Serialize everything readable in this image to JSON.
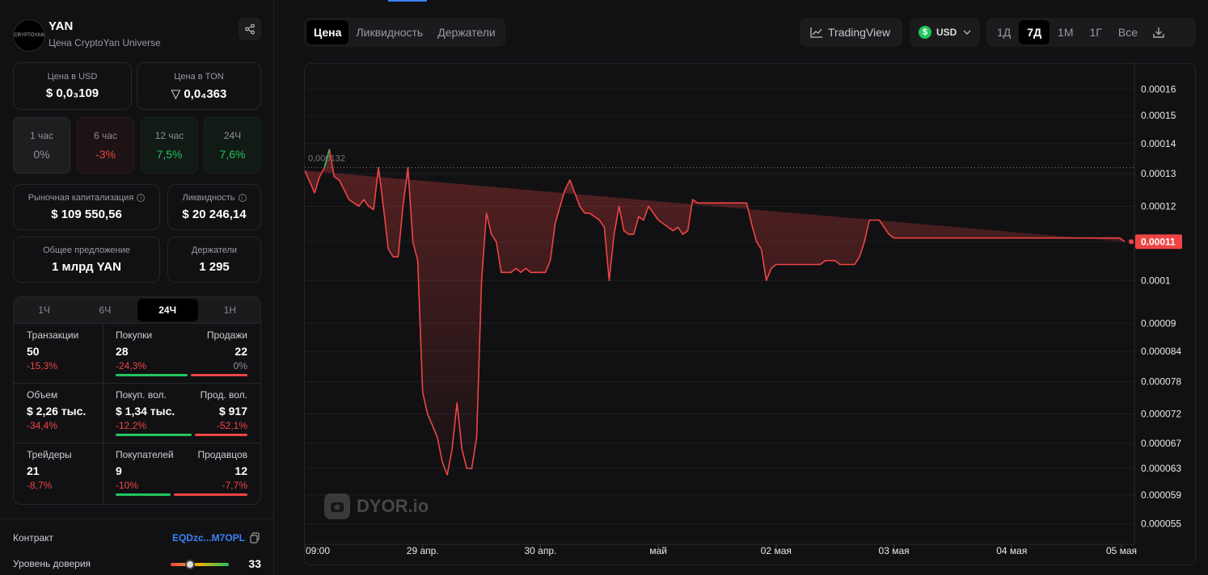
{
  "token": {
    "name": "YAN",
    "subtitle": "Цена CryptoYan Universe",
    "logo_text": "CRYPTOYAN"
  },
  "price": {
    "usd_label": "Цена в USD",
    "usd_value": "$ 0,0₃109",
    "ton_label": "Цена в TON",
    "ton_value": "▽ 0,0₄363"
  },
  "changes": [
    {
      "label": "1 час",
      "value": "0%",
      "tone": "neutral"
    },
    {
      "label": "6 час",
      "value": "-3%",
      "tone": "negative"
    },
    {
      "label": "12 час",
      "value": "7,5%",
      "tone": "positive"
    },
    {
      "label": "24Ч",
      "value": "7,6%",
      "tone": "positive"
    }
  ],
  "metrics": {
    "mcap_label": "Рыночная капитализация",
    "mcap_value": "$ 109 550,56",
    "liq_label": "Ликвидность",
    "liq_value": "$ 20 246,14",
    "supply_label": "Общее предложение",
    "supply_value": "1 млрд YAN",
    "holders_label": "Держатели",
    "holders_value": "1 295"
  },
  "stats": {
    "timeframes": [
      "1Ч",
      "6Ч",
      "24Ч",
      "1Н"
    ],
    "active_timeframe": "24Ч",
    "rows": [
      {
        "a": {
          "label": "Транзакции",
          "value": "50",
          "pct": "-15,3%"
        },
        "b": {
          "label": "Покупки",
          "value": "28",
          "pct": "-24,3%"
        },
        "c": {
          "label": "Продажи",
          "value": "22",
          "pct": "0%"
        },
        "buy_share": 0.56
      },
      {
        "a": {
          "label": "Объем",
          "value": "$ 2,26 тыс.",
          "pct": "-34,4%"
        },
        "b": {
          "label": "Покуп. вол.",
          "value": "$ 1,34 тыс.",
          "pct": "-12,2%"
        },
        "c": {
          "label": "Прод. вол.",
          "value": "$ 917",
          "pct": "-52,1%"
        },
        "buy_share": 0.59
      },
      {
        "a": {
          "label": "Трейдеры",
          "value": "21",
          "pct": "-8,7%"
        },
        "b": {
          "label": "Покупателей",
          "value": "9",
          "pct": "-10%"
        },
        "c": {
          "label": "Продавцов",
          "value": "12",
          "pct": "-7,7%"
        },
        "buy_share": 0.43
      }
    ]
  },
  "contract": {
    "label": "Контракт",
    "value": "EQDzc...M7OPL"
  },
  "trust": {
    "label": "Уровень доверия",
    "value": "33",
    "level": 0.33
  },
  "tabs": [
    "Цена",
    "Ликвидность",
    "Держатели"
  ],
  "active_tab": "Цена",
  "toolbar": {
    "tradingview": "TradingView",
    "currency": "USD",
    "ranges": [
      "1Д",
      "7Д",
      "1М",
      "1Г",
      "Все"
    ],
    "active_range": "7Д"
  },
  "colors": {
    "up": "#22c55e",
    "down": "#ef4444",
    "accent": "#3b82f6"
  },
  "watermark": "DYOR.io",
  "chart_data": {
    "type": "line",
    "scale": "log",
    "ylim": [
      5.3e-05,
      0.000167
    ],
    "yticks": [
      "0.00016",
      "0.00015",
      "0.00014",
      "0.00013",
      "0.00012",
      "0.00011",
      "0.0001",
      "0.00009",
      "0.000084",
      "0.000078",
      "0.000072",
      "0.000067",
      "0.000063",
      "0.000059",
      "0.000055"
    ],
    "xticks": [
      "09:00",
      "29 апр.",
      "30 апр.",
      "май",
      "02 мая",
      "03 мая",
      "04 мая",
      "05 мая"
    ],
    "reference_line": {
      "label": "0,000132",
      "value": 0.000132
    },
    "last_price": {
      "label": "0.00011",
      "value": 0.00011
    },
    "x_hours": [
      0,
      2,
      3,
      4,
      5,
      6,
      7,
      8,
      9,
      10,
      11,
      12,
      13,
      14,
      15,
      16,
      17,
      18,
      19,
      20,
      21,
      22,
      23,
      24,
      25,
      26,
      27,
      28,
      29,
      30,
      31,
      32,
      33,
      34,
      35,
      36,
      37,
      38,
      39,
      40,
      41,
      42,
      43,
      44,
      45,
      46,
      47,
      48,
      49,
      50,
      51,
      52,
      53,
      54,
      55,
      56,
      57,
      58,
      59,
      60,
      61,
      62,
      63,
      64,
      65,
      66,
      67,
      68,
      69,
      70,
      71,
      72,
      73,
      74,
      75,
      76,
      77,
      78,
      79,
      80,
      81,
      82,
      83,
      84,
      85,
      86,
      87,
      88,
      89,
      90,
      91,
      92,
      93,
      94,
      95,
      96,
      97,
      98,
      99,
      100,
      101,
      102,
      103,
      104,
      105,
      106,
      107,
      108,
      109,
      110,
      111,
      112,
      113,
      114,
      115,
      116,
      117,
      118,
      119,
      120,
      121,
      122,
      123,
      124,
      125,
      126,
      127,
      128,
      129,
      130,
      131,
      132,
      133,
      134,
      135,
      136,
      137,
      138,
      139,
      140,
      141,
      142,
      143,
      144,
      145,
      146,
      147,
      148,
      149,
      150,
      151,
      152,
      153,
      154,
      155,
      156,
      157,
      158,
      159,
      160,
      161,
      162,
      163,
      164,
      165,
      166,
      167,
      168
    ],
    "values": [
      0.000131,
      0.000124,
      0.000129,
      0.000132,
      0.000138,
      0.000129,
      0.000128,
      0.000125,
      0.000122,
      0.000121,
      0.00012,
      0.000122,
      0.00012,
      0.000119,
      0.000132,
      0.00012,
      0.000108,
      0.000106,
      0.000106,
      0.00012,
      0.000132,
      0.00011,
      0.000105,
      7.6e-05,
      7.2e-05,
      7e-05,
      6.8e-05,
      6.4e-05,
      6.2e-05,
      6.6e-05,
      7.4e-05,
      6.6e-05,
      6.3e-05,
      6.3e-05,
      6.8e-05,
      0.0001,
      0.000118,
      0.000112,
      0.00011,
      0.000102,
      0.000102,
      0.000102,
      0.000103,
      0.000102,
      0.000103,
      0.000102,
      0.000102,
      0.000102,
      0.000102,
      0.000105,
      0.000115,
      0.00012,
      0.000125,
      0.000128,
      0.000124,
      0.00012,
      0.000118,
      0.000118,
      0.000117,
      0.000116,
      0.000114,
      0.0001,
      0.000112,
      0.00012,
      0.000113,
      0.000112,
      0.000112,
      0.000117,
      0.000116,
      0.00012,
      0.000118,
      0.000116,
      0.000115,
      0.000114,
      0.000113,
      0.000114,
      0.000112,
      0.000113,
      0.000122,
      0.000121,
      0.000121,
      0.000121,
      0.000121,
      0.000121,
      0.000121,
      0.000121,
      0.000121,
      0.000121,
      0.000121,
      0.000121,
      0.000115,
      0.00011,
      0.000108,
      0.0001,
      0.000103,
      0.000104,
      0.000104,
      0.000104,
      0.000104,
      0.000104,
      0.000104,
      0.000104,
      0.000104,
      0.000104,
      0.000104,
      0.000105,
      0.000105,
      0.000105,
      0.000104,
      0.000104,
      0.000104,
      0.000104,
      0.000106,
      0.00011,
      0.000116,
      0.000116,
      0.000116,
      0.000114,
      0.000112,
      0.000111,
      0.000111,
      0.000111,
      0.000111,
      0.000111,
      0.000111,
      0.000111,
      0.000111,
      0.000111,
      0.000111,
      0.000111,
      0.000111,
      0.000111,
      0.000111,
      0.000111,
      0.000111,
      0.000111,
      0.000111,
      0.000111,
      0.000111,
      0.000111,
      0.000111,
      0.000111,
      0.000111,
      0.000111,
      0.000111,
      0.000111,
      0.000111,
      0.000111,
      0.000111,
      0.000111,
      0.000111,
      0.000111,
      0.000111,
      0.000111,
      0.000111,
      0.000111,
      0.000111,
      0.000111,
      0.000111,
      0.000111,
      0.000111,
      0.000111,
      0.000111,
      0.000111,
      0.000111,
      0.000111,
      0.00011
    ],
    "xrange_hours": [
      0,
      168
    ]
  }
}
